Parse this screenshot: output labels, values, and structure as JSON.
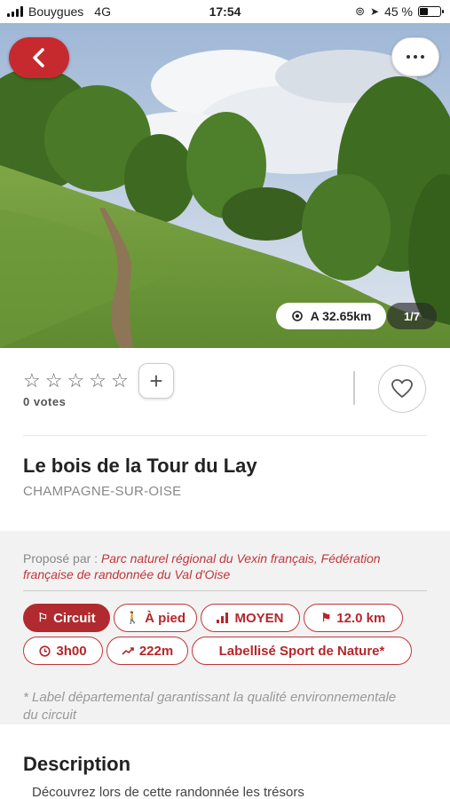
{
  "status_bar": {
    "carrier": "Bouygues",
    "network": "4G",
    "time": "17:54",
    "battery": "45 %",
    "battery_level": 0.45
  },
  "hero": {
    "distance": "A 32.65km",
    "photo_counter": "1/7"
  },
  "rating": {
    "stars": 0,
    "votes": "0 votes"
  },
  "trail": {
    "title": "Le bois de la Tour du Lay",
    "location": "CHAMPAGNE-SUR-OISE"
  },
  "proposed": {
    "label": "Proposé par : ",
    "organization": "Parc naturel régional du Vexin français, Fédération française de randonnée du Val d'Oise"
  },
  "tags": [
    {
      "label": "Circuit",
      "icon": "signpost-icon",
      "active": true
    },
    {
      "label": "À pied",
      "icon": "walker-icon",
      "active": false
    },
    {
      "label": "MOYEN",
      "icon": "difficulty-bars-icon",
      "active": false
    },
    {
      "label": "12.0 km",
      "icon": "flag-icon",
      "active": false
    },
    {
      "label": "3h00",
      "icon": "clock-icon",
      "active": false
    },
    {
      "label": "222m",
      "icon": "elevation-trend-icon",
      "active": false
    },
    {
      "label": "Labellisé Sport de Nature*",
      "icon": "",
      "active": false
    }
  ],
  "footnote": "* Label départemental garantissant la qualité environnementale du circuit",
  "description": {
    "title": "Description",
    "text": "Découvrez lors de cette randonnée les trésors"
  },
  "colors": {
    "accent": "#c62a2f",
    "tag_border": "#c0363a"
  }
}
